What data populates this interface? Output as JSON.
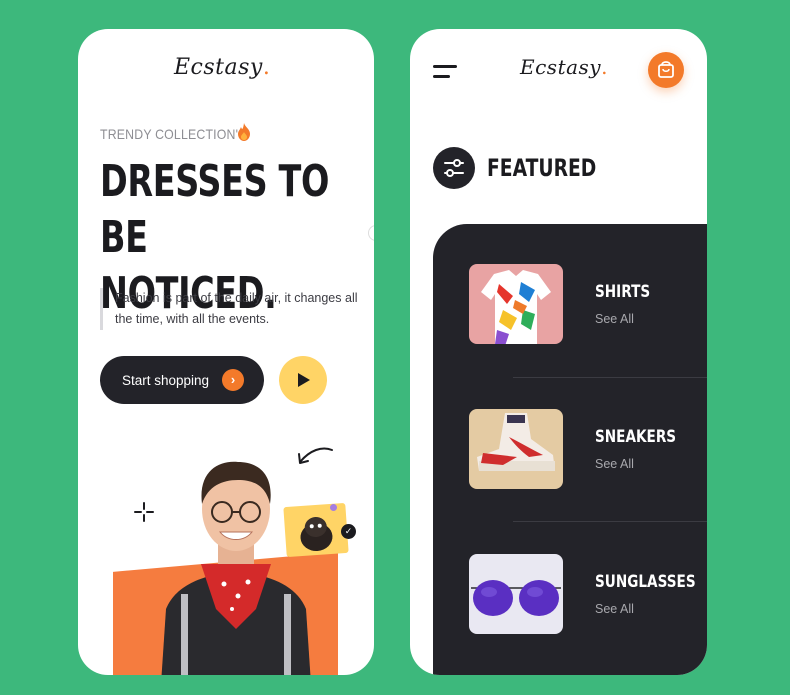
{
  "left": {
    "logo": "Ecstasy",
    "logo_dot": ".",
    "tagline": "TRENDY COLLECTION'S",
    "headline_line1": "DRESSES TO BE",
    "headline_line2": "NOTICED.",
    "description": "Fashion is part of the daily air, it changes all the time, with all the events.",
    "start_button": "Start shopping",
    "start_arrow": "›",
    "play_icon": "play-icon"
  },
  "right": {
    "logo": "Ecstasy",
    "logo_dot": ".",
    "section_title": "FEATURED",
    "categories": [
      {
        "name": "SHIRTS",
        "link": "See All"
      },
      {
        "name": "SNEAKERS",
        "link": "See All"
      },
      {
        "name": "SUNGLASSES",
        "link": "See All"
      }
    ]
  },
  "colors": {
    "background": "#3db87c",
    "accent_orange": "#f37a2a",
    "accent_yellow": "#ffd466",
    "dark": "#232329"
  }
}
